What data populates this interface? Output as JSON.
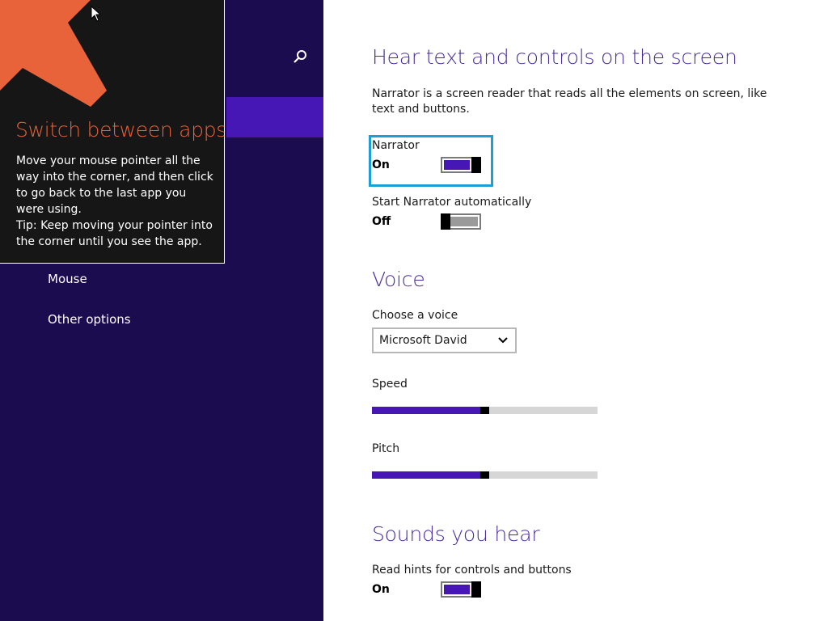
{
  "left_nav": {
    "items": [
      {
        "label": "Mouse"
      },
      {
        "label": "Other options"
      }
    ]
  },
  "tip": {
    "title": "Switch between apps",
    "body": "Move your mouse pointer all the way into the corner, and then click to go back to the last app you were using.",
    "tip_line": "Tip: Keep moving your pointer into the corner until you see the app.",
    "arrow_color": "#e8623a"
  },
  "narrator_section": {
    "heading": "Hear text and controls on the screen",
    "description": "Narrator is a screen reader that reads all the elements on screen, like text and buttons.",
    "narrator": {
      "label": "Narrator",
      "state": "On"
    },
    "auto_start": {
      "label": "Start Narrator automatically",
      "state": "Off"
    }
  },
  "voice_section": {
    "heading": "Voice",
    "choose_label": "Choose a voice",
    "selected_voice": "Microsoft David",
    "speed": {
      "label": "Speed",
      "value": 0.5
    },
    "pitch": {
      "label": "Pitch",
      "value": 0.5
    }
  },
  "sounds_section": {
    "heading": "Sounds you hear",
    "read_hints": {
      "label": "Read hints for controls and buttons",
      "state": "On"
    }
  },
  "colors": {
    "accent": "#4617b4",
    "nav_background": "#1b0b4f",
    "focus": "#1b9fd6",
    "heading": "#4a2c9c"
  }
}
